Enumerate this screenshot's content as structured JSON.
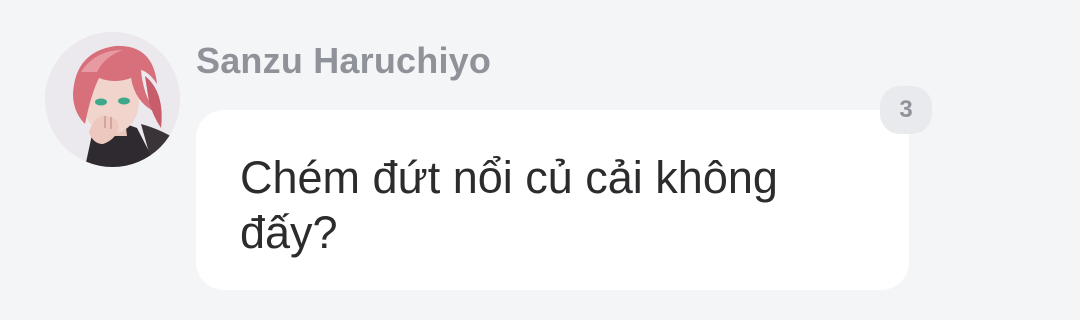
{
  "message": {
    "sender_name": "Sanzu Haruchiyo",
    "avatar_icon": "user-avatar-icon",
    "text": "Chém đứt nổi củ cải không đấy?",
    "reaction_count": "3"
  },
  "colors": {
    "background": "#f4f5f7",
    "bubble": "#ffffff",
    "sender_name": "#8f9399",
    "message_text": "#2c2c2e",
    "badge_background": "#e9eaed"
  }
}
